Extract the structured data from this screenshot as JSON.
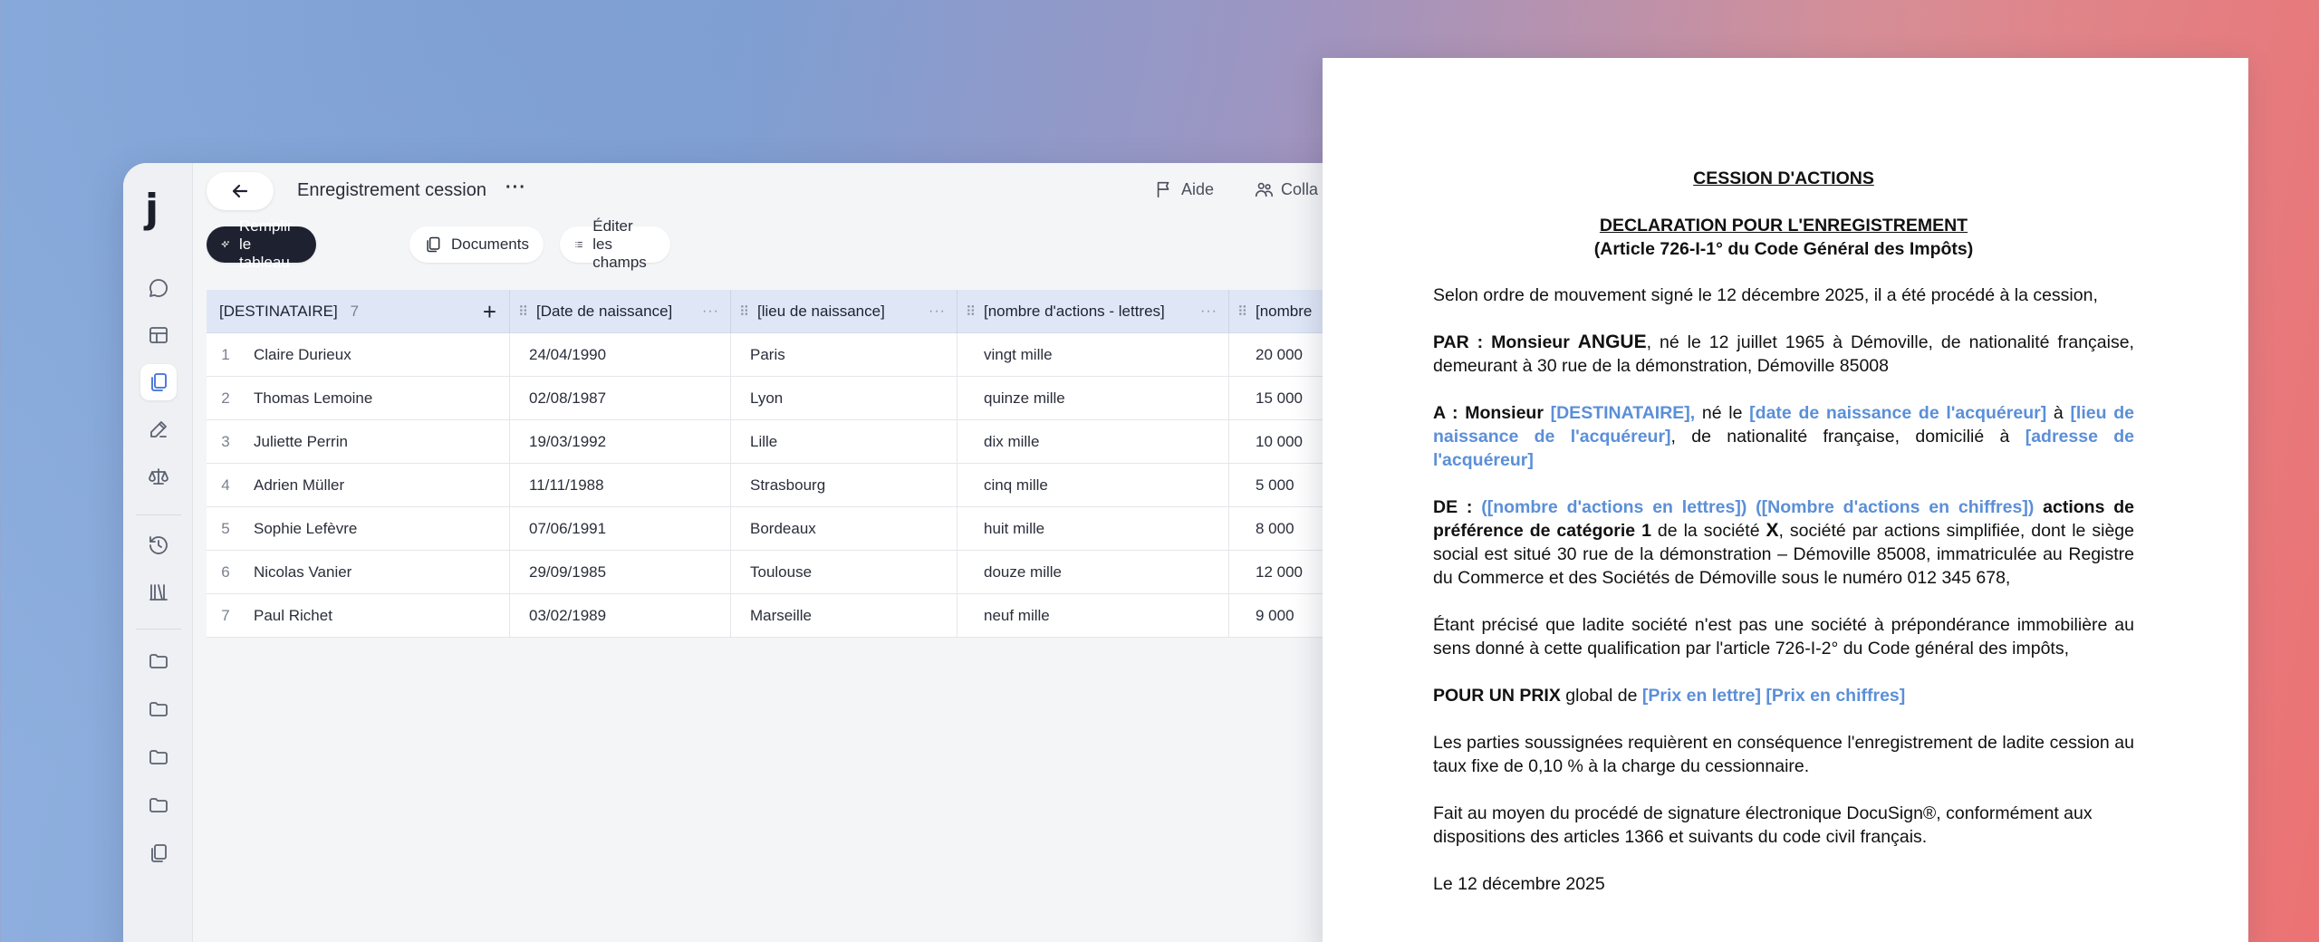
{
  "app": {
    "logo": "j",
    "page_title": "Enregistrement cession",
    "more": "···",
    "help_label": "Aide",
    "collab_label": "Colla"
  },
  "rail_icons": [
    "chat-icon",
    "table-icon",
    "documents-icon",
    "edit-icon",
    "scales-icon",
    "history-icon",
    "library-icon",
    "folder-icon",
    "folder-icon",
    "folder-icon",
    "folder-icon",
    "copy-icon"
  ],
  "toolbar": {
    "fill_table": "Remplir le tableau",
    "documents": "Documents",
    "edit_fields": "Éditer les champs"
  },
  "table": {
    "columns": [
      {
        "label": "[DESTINATAIRE]",
        "count": "7"
      },
      {
        "label": "[Date de naissance]"
      },
      {
        "label": "[lieu de naissance]"
      },
      {
        "label": "[nombre d'actions - lettres]"
      },
      {
        "label": "[nombre"
      }
    ],
    "rows": [
      {
        "n": "1",
        "dest": "Claire Durieux",
        "date": "24/04/1990",
        "lieu": "Paris",
        "lettres": "vingt mille",
        "chiffres": "20 000"
      },
      {
        "n": "2",
        "dest": "Thomas Lemoine",
        "date": "02/08/1987",
        "lieu": "Lyon",
        "lettres": "quinze mille",
        "chiffres": "15 000"
      },
      {
        "n": "3",
        "dest": "Juliette Perrin",
        "date": "19/03/1992",
        "lieu": "Lille",
        "lettres": "dix mille",
        "chiffres": "10 000"
      },
      {
        "n": "4",
        "dest": "Adrien Müller",
        "date": "11/11/1988",
        "lieu": "Strasbourg",
        "lettres": "cinq mille",
        "chiffres": "5 000"
      },
      {
        "n": "5",
        "dest": "Sophie Lefèvre",
        "date": "07/06/1991",
        "lieu": "Bordeaux",
        "lettres": "huit mille",
        "chiffres": "8 000"
      },
      {
        "n": "6",
        "dest": "Nicolas Vanier",
        "date": "29/09/1985",
        "lieu": "Toulouse",
        "lettres": "douze mille",
        "chiffres": "12 000"
      },
      {
        "n": "7",
        "dest": "Paul Richet",
        "date": "03/02/1989",
        "lieu": "Marseille",
        "lettres": "neuf mille",
        "chiffres": "9 000"
      }
    ]
  },
  "doc": {
    "title": "CESSION D'ACTIONS",
    "subtitle": "DECLARATION POUR L'ENREGISTREMENT",
    "article": "(Article 726-I-1° du Code Général des Impôts)",
    "p1": "Selon ordre de mouvement signé le 12 décembre 2025, il a été procédé à la cession,",
    "p2_par": "PAR : Monsieur ",
    "p2_name": "ANGUE",
    "p2_rest": ", né le 12 juillet 1965 à Démoville, de nationalité française, demeurant à 30 rue de la démonstration, Démoville 85008",
    "p3_a": "A : Monsieur ",
    "p3_ph1": "[DESTINATAIRE],",
    "p3_t1": " né le ",
    "p3_ph2": "[date de naissance de l'acquéreur]",
    "p3_t2": " à ",
    "p3_ph3": "[lieu de naissance de l'acquéreur]",
    "p3_t3": ", de nationalité française, domicilié à ",
    "p3_ph4": "[adresse de l'acquéreur]",
    "p4_de": "DE : ",
    "p4_ph1": "([nombre d'actions en lettres])",
    "p4_ph2": "([Nombre d'actions en chiffres])",
    "p4_b1": " actions de préférence de catégorie 1",
    "p4_t1": " de la société ",
    "p4_x": "X",
    "p4_t2": ", société par actions simplifiée, dont le siège social est situé 30 rue de la démonstration – Démoville 85008, immatriculée au Registre du Commerce et des Sociétés de Démoville sous le numéro 012 345 678,",
    "p5": "Étant précisé que ladite société n'est pas une société à prépondérance immobilière au sens donné à cette qualification par l'article 726-I-2° du Code général des impôts,",
    "p6_b": "POUR UN PRIX",
    "p6_t": " global de ",
    "p6_ph": "[Prix en lettre] [Prix en chiffres]",
    "p7": "Les parties soussignées requièrent en conséquence l'enregistrement de ladite cession au taux fixe de 0,10 % à la charge du cessionnaire.",
    "p8": "Fait au moyen du procédé de signature électronique DocuSign®, conformément aux dispositions des articles 1366 et suivants du code civil français.",
    "p9": "Le 12 décembre 2025"
  }
}
